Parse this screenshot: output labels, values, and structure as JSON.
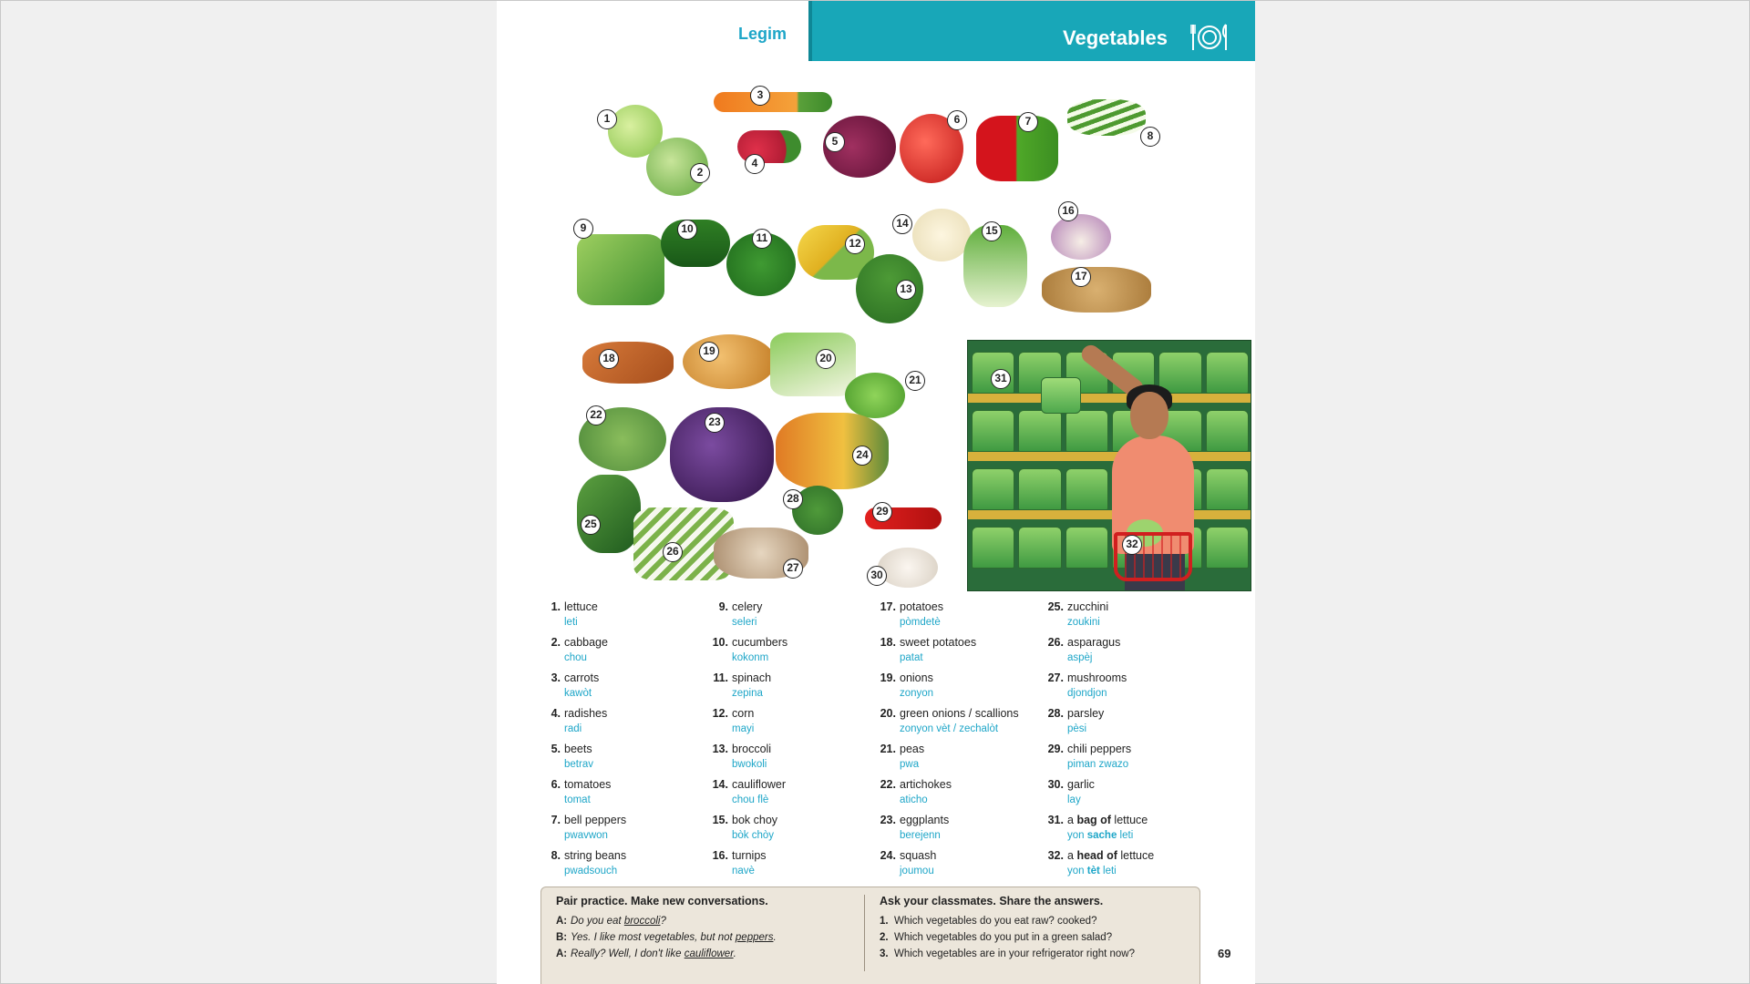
{
  "header": {
    "left_title": "Legim",
    "right_title": "Vegetables"
  },
  "callouts": [
    "1",
    "2",
    "3",
    "4",
    "5",
    "6",
    "7",
    "8",
    "9",
    "10",
    "11",
    "12",
    "13",
    "14",
    "15",
    "16",
    "17",
    "18",
    "19",
    "20",
    "21",
    "22",
    "23",
    "24",
    "25",
    "26",
    "27",
    "28",
    "29",
    "30",
    "31",
    "32"
  ],
  "vocab": [
    {
      "num": "1.",
      "en": "lettuce",
      "ht": "leti"
    },
    {
      "num": "2.",
      "en": "cabbage",
      "ht": "chou"
    },
    {
      "num": "3.",
      "en": "carrots",
      "ht": "kawòt"
    },
    {
      "num": "4.",
      "en": "radishes",
      "ht": "radi"
    },
    {
      "num": "5.",
      "en": "beets",
      "ht": "betrav"
    },
    {
      "num": "6.",
      "en": "tomatoes",
      "ht": "tomat"
    },
    {
      "num": "7.",
      "en": "bell peppers",
      "ht": "pwavwon"
    },
    {
      "num": "8.",
      "en": "string beans",
      "ht": "pwadsouch"
    },
    {
      "num": "9.",
      "en": "celery",
      "ht": "seleri"
    },
    {
      "num": "10.",
      "en": "cucumbers",
      "ht": "kokonm"
    },
    {
      "num": "11.",
      "en": "spinach",
      "ht": "zepina"
    },
    {
      "num": "12.",
      "en": "corn",
      "ht": "mayi"
    },
    {
      "num": "13.",
      "en": "broccoli",
      "ht": "bwokoli"
    },
    {
      "num": "14.",
      "en": "cauliflower",
      "ht": "chou flè"
    },
    {
      "num": "15.",
      "en": "bok choy",
      "ht": "bòk chòy"
    },
    {
      "num": "16.",
      "en": "turnips",
      "ht": "navè"
    },
    {
      "num": "17.",
      "en": "potatoes",
      "ht": "pòmdetè"
    },
    {
      "num": "18.",
      "en": "sweet potatoes",
      "ht": "patat"
    },
    {
      "num": "19.",
      "en": "onions",
      "ht": "zonyon"
    },
    {
      "num": "20.",
      "en": "green onions / scallions",
      "ht": "zonyon vèt / zechalòt"
    },
    {
      "num": "21.",
      "en": "peas",
      "ht": "pwa"
    },
    {
      "num": "22.",
      "en": "artichokes",
      "ht": "aticho"
    },
    {
      "num": "23.",
      "en": "eggplants",
      "ht": "berejenn"
    },
    {
      "num": "24.",
      "en": "squash",
      "ht": "joumou"
    },
    {
      "num": "25.",
      "en": "zucchini",
      "ht": "zoukini"
    },
    {
      "num": "26.",
      "en": "asparagus",
      "ht": "aspèj"
    },
    {
      "num": "27.",
      "en": "mushrooms",
      "ht": "djondjon"
    },
    {
      "num": "28.",
      "en": "parsley",
      "ht": "pèsi"
    },
    {
      "num": "29.",
      "en": "chili peppers",
      "ht": "piman zwazo"
    },
    {
      "num": "30.",
      "en": "garlic",
      "ht": "lay"
    },
    {
      "num": "31.",
      "en_pre": "a ",
      "en_bold": "bag of",
      "en_post": " lettuce",
      "ht_pre": "yon ",
      "ht_bold": "sache",
      "ht_post": " leti"
    },
    {
      "num": "32.",
      "en_pre": "a ",
      "en_bold": "head of",
      "en_post": " lettuce",
      "ht_pre": "yon ",
      "ht_bold": "tèt",
      "ht_post": " leti"
    }
  ],
  "pair_practice": {
    "heading": "Pair practice. Make new conversations.",
    "lines": [
      {
        "speaker": "A:",
        "pre": "Do you eat ",
        "u": "broccoli",
        "post": "?"
      },
      {
        "speaker": "B:",
        "pre": "Yes. I like most vegetables, but not ",
        "u": "peppers",
        "post": "."
      },
      {
        "speaker": "A:",
        "pre": "Really? Well, I don't like ",
        "u": "cauliflower",
        "post": "."
      }
    ]
  },
  "ask_classmates": {
    "heading": "Ask your classmates. Share the answers.",
    "questions": [
      {
        "num": "1.",
        "text": "Which vegetables do you eat raw? cooked?"
      },
      {
        "num": "2.",
        "text": "Which vegetables do you put in a green salad?"
      },
      {
        "num": "3.",
        "text": "Which vegetables are in your refrigerator right now?"
      }
    ]
  },
  "page_number": "69",
  "colors": {
    "header_band": "#18a7b8",
    "header_accent_text": "#1ea6c8",
    "translation_text": "#1ea6c8",
    "practice_box": "#ece6db"
  }
}
